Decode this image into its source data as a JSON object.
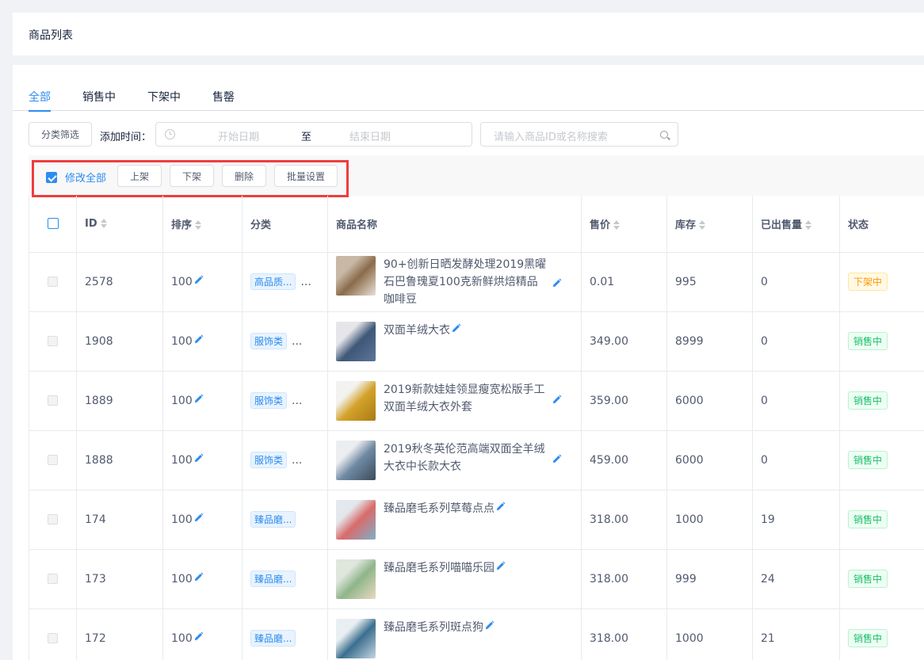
{
  "page_title": "商品列表",
  "tabs": [
    {
      "label": "全部",
      "active": true
    },
    {
      "label": "销售中",
      "active": false
    },
    {
      "label": "下架中",
      "active": false
    },
    {
      "label": "售罄",
      "active": false
    }
  ],
  "filters": {
    "category_button": "分类筛选",
    "time_label": "添加时间：",
    "start_placeholder": "开始日期",
    "separator": "至",
    "end_placeholder": "结束日期",
    "search_placeholder": "请输入商品ID或名称搜索"
  },
  "actions": {
    "edit_all": "修改全部",
    "up": "上架",
    "down": "下架",
    "delete": "删除",
    "batch": "批量设置"
  },
  "columns": [
    "ID",
    "排序",
    "分类",
    "商品名称",
    "售价",
    "库存",
    "已出售量",
    "状态"
  ],
  "rows": [
    {
      "id": "2578",
      "sort": "100",
      "category": "高品质...",
      "more": "...",
      "name": "90+创新日晒发酵处理2019黑曜石巴鲁瑰夏100克新鲜烘焙精品咖啡豆",
      "price": "0.01",
      "stock": "995",
      "sold": "0",
      "status": "下架中",
      "status_type": "off",
      "thumb_colors": [
        "#c8b8a6",
        "#8b6b4a",
        "#e9e2d8"
      ]
    },
    {
      "id": "1908",
      "sort": "100",
      "category": "服饰类",
      "more": "...",
      "name": "双面羊绒大衣",
      "price": "349.00",
      "stock": "8999",
      "sold": "0",
      "status": "销售中",
      "status_type": "on",
      "thumb_colors": [
        "#e6e6ea",
        "#3f5878",
        "#5c7499"
      ]
    },
    {
      "id": "1889",
      "sort": "100",
      "category": "服饰类",
      "more": "...",
      "name": "2019新款娃娃领显瘦宽松版手工双面羊绒大衣外套",
      "price": "359.00",
      "stock": "6000",
      "sold": "0",
      "status": "销售中",
      "status_type": "on",
      "thumb_colors": [
        "#f2f2f0",
        "#d4a22a",
        "#a87c15"
      ]
    },
    {
      "id": "1888",
      "sort": "100",
      "category": "服饰类",
      "more": "...",
      "name": "2019秋冬英伦范高端双面全羊绒大衣中长款大衣",
      "price": "459.00",
      "stock": "6000",
      "sold": "0",
      "status": "销售中",
      "status_type": "on",
      "thumb_colors": [
        "#ecedef",
        "#6f8aa3",
        "#3c4b5a"
      ]
    },
    {
      "id": "174",
      "sort": "100",
      "category": "臻品磨...",
      "more": "",
      "name": "臻品磨毛系列草莓点点",
      "price": "318.00",
      "stock": "1000",
      "sold": "19",
      "status": "销售中",
      "status_type": "on",
      "thumb_colors": [
        "#e3e8ec",
        "#d96b6b",
        "#7fb0c8"
      ]
    },
    {
      "id": "173",
      "sort": "100",
      "category": "臻品磨...",
      "more": "",
      "name": "臻品磨毛系列喵喵乐园",
      "price": "318.00",
      "stock": "999",
      "sold": "24",
      "status": "销售中",
      "status_type": "on",
      "thumb_colors": [
        "#dfe6dc",
        "#8fb58a",
        "#e9d9c2"
      ]
    },
    {
      "id": "172",
      "sort": "100",
      "category": "臻品磨...",
      "more": "",
      "name": "臻品磨毛系列斑点狗",
      "price": "318.00",
      "stock": "1000",
      "sold": "21",
      "status": "销售中",
      "status_type": "on",
      "thumb_colors": [
        "#e8eef2",
        "#3b6e8f",
        "#c7d6e0"
      ]
    }
  ]
}
